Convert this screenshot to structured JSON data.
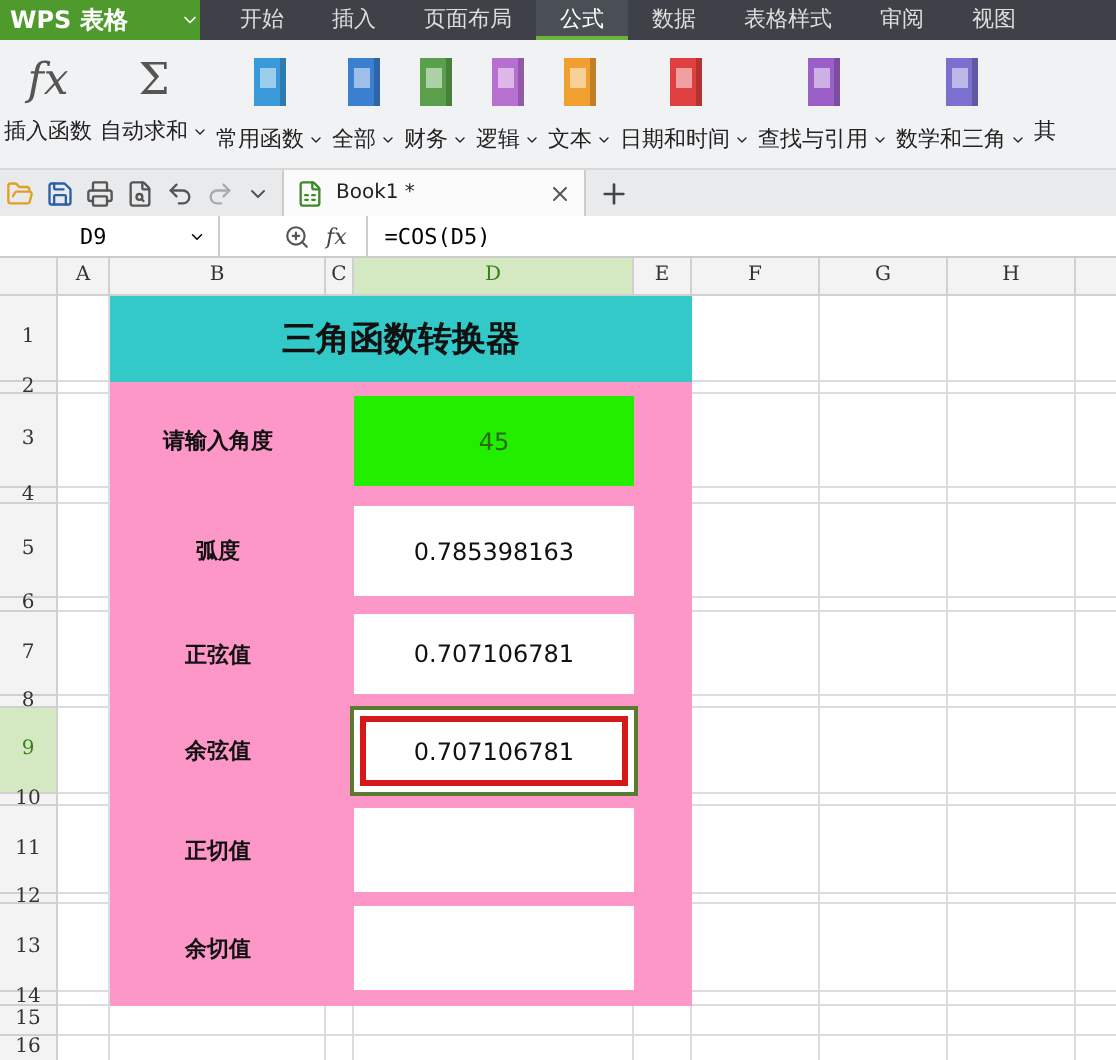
{
  "app_title": "WPS 表格",
  "menu_tabs": [
    {
      "label": "开始",
      "selected": false
    },
    {
      "label": "插入",
      "selected": false
    },
    {
      "label": "页面布局",
      "selected": false
    },
    {
      "label": "公式",
      "selected": true
    },
    {
      "label": "数据",
      "selected": false
    },
    {
      "label": "表格样式",
      "selected": false
    },
    {
      "label": "审阅",
      "selected": false
    },
    {
      "label": "视图",
      "selected": false
    }
  ],
  "ribbon": [
    {
      "kind": "glyph",
      "glyph": "fx",
      "label": "插入函数",
      "dropdown": false
    },
    {
      "kind": "glyph",
      "glyph": "Σ",
      "label": "自动求和",
      "dropdown": true
    },
    {
      "kind": "book",
      "color": "#3a9ad9",
      "label": "常用函数",
      "dropdown": true
    },
    {
      "kind": "book",
      "color": "#3b7fd0",
      "label": "全部",
      "dropdown": true
    },
    {
      "kind": "book",
      "color": "#5aa04a",
      "label": "财务",
      "dropdown": true
    },
    {
      "kind": "book",
      "color": "#b770d0",
      "label": "逻辑",
      "dropdown": true
    },
    {
      "kind": "book",
      "color": "#f0a030",
      "label": "文本",
      "dropdown": true
    },
    {
      "kind": "book",
      "color": "#e04040",
      "label": "日期和时间",
      "dropdown": true
    },
    {
      "kind": "book",
      "color": "#9a60c8",
      "label": "查找与引用",
      "dropdown": true
    },
    {
      "kind": "book",
      "color": "#7a70d0",
      "label": "数学和三角",
      "dropdown": true
    },
    {
      "kind": "cut",
      "label": "其",
      "dropdown": false
    }
  ],
  "document_tab": {
    "title": "Book1 *"
  },
  "name_box": "D9",
  "fx_label": "fx",
  "formula": "=COS(D5)",
  "columns": [
    {
      "label": "A",
      "selected": false
    },
    {
      "label": "B",
      "selected": false
    },
    {
      "label": "C",
      "selected": false
    },
    {
      "label": "D",
      "selected": true
    },
    {
      "label": "E",
      "selected": false
    },
    {
      "label": "F",
      "selected": false
    },
    {
      "label": "G",
      "selected": false
    },
    {
      "label": "H",
      "selected": false
    }
  ],
  "rows": [
    {
      "label": "1",
      "selected": false
    },
    {
      "label": "2",
      "selected": false
    },
    {
      "label": "3",
      "selected": false
    },
    {
      "label": "4",
      "selected": false
    },
    {
      "label": "5",
      "selected": false
    },
    {
      "label": "6",
      "selected": false
    },
    {
      "label": "7",
      "selected": false
    },
    {
      "label": "8",
      "selected": false
    },
    {
      "label": "9",
      "selected": true
    },
    {
      "label": "10",
      "selected": false
    },
    {
      "label": "11",
      "selected": false
    },
    {
      "label": "12",
      "selected": false
    },
    {
      "label": "13",
      "selected": false
    },
    {
      "label": "14",
      "selected": false
    },
    {
      "label": "15",
      "selected": false
    },
    {
      "label": "16",
      "selected": false
    }
  ],
  "sheet": {
    "title": "三角函数转换器",
    "fields": [
      {
        "label": "请输入角度",
        "value": "45",
        "kind": "input",
        "selected": false
      },
      {
        "label": "弧度",
        "value": "0.785398163",
        "kind": "output",
        "selected": false
      },
      {
        "label": "正弦值",
        "value": "0.707106781",
        "kind": "output",
        "selected": false
      },
      {
        "label": "余弦值",
        "value": "0.707106781",
        "kind": "output",
        "selected": true
      },
      {
        "label": "正切值",
        "kind": "output",
        "selected": false
      },
      {
        "label": "余切值",
        "kind": "output",
        "selected": false
      }
    ]
  }
}
